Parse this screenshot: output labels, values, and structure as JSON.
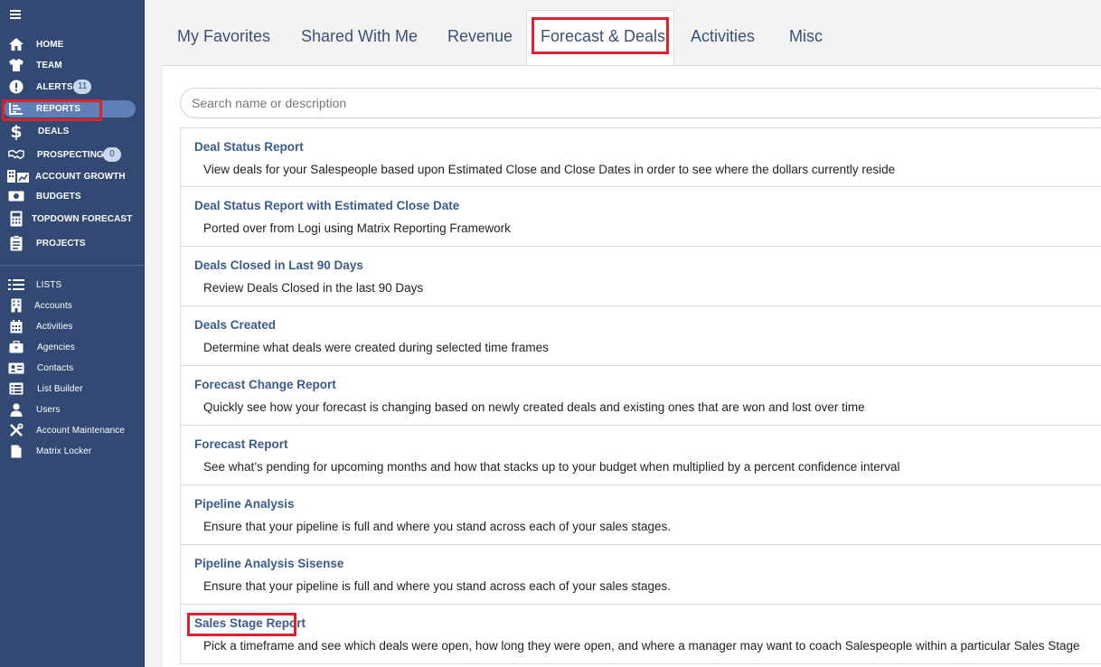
{
  "sidebar": {
    "main_items": [
      {
        "label": "HOME",
        "icon": "home-icon"
      },
      {
        "label": "TEAM",
        "icon": "shirt-icon"
      },
      {
        "label": "ALERTS",
        "icon": "alert-icon",
        "badge": "11"
      },
      {
        "label": "REPORTS",
        "icon": "report-chart-icon"
      },
      {
        "label": "DEALS",
        "icon": "dollar-icon"
      },
      {
        "label": "PROSPECTING",
        "icon": "handshake-icon",
        "badge": "0"
      },
      {
        "label": "ACCOUNT GROWTH",
        "icon": "building-chart-icon"
      },
      {
        "label": "BUDGETS",
        "icon": "money-bill-icon"
      },
      {
        "label": "TOPDOWN FORECAST",
        "icon": "calculator-icon"
      },
      {
        "label": "PROJECTS",
        "icon": "clipboard-icon"
      }
    ],
    "lists_header": "LISTS",
    "list_items": [
      {
        "label": "Accounts",
        "icon": "building-icon"
      },
      {
        "label": "Activities",
        "icon": "calendar-icon"
      },
      {
        "label": "Agencies",
        "icon": "briefcase-icon"
      },
      {
        "label": "Contacts",
        "icon": "contact-card-icon"
      },
      {
        "label": "List Builder",
        "icon": "list-builder-icon"
      },
      {
        "label": "Users",
        "icon": "user-icon"
      },
      {
        "label": "Account Maintenance",
        "icon": "tools-icon"
      },
      {
        "label": "Matrix Locker",
        "icon": "file-icon"
      }
    ]
  },
  "tabs": [
    {
      "label": "My Favorites"
    },
    {
      "label": "Shared With Me"
    },
    {
      "label": "Revenue"
    },
    {
      "label": "Forecast & Deals",
      "active": true
    },
    {
      "label": "Activities"
    },
    {
      "label": "Misc"
    }
  ],
  "search": {
    "placeholder": "Search name or description",
    "value": ""
  },
  "reports": [
    {
      "title": "Deal Status Report",
      "description": "View deals for your Salespeople based upon Estimated Close and Close Dates in order to see where the dollars currently reside"
    },
    {
      "title": "Deal Status Report with Estimated Close Date",
      "description": "Ported over from Logi using Matrix Reporting Framework"
    },
    {
      "title": "Deals Closed in Last 90 Days",
      "description": "Review Deals Closed in the last 90 Days"
    },
    {
      "title": "Deals Created",
      "description": "Determine what deals were created during selected time frames"
    },
    {
      "title": "Forecast Change Report",
      "description": "Quickly see how your forecast is changing based on newly created deals and existing ones that are won and lost over time"
    },
    {
      "title": "Forecast Report",
      "description": "See what’s pending for upcoming months and how that stacks up to your budget when multiplied by a percent confidence interval"
    },
    {
      "title": "Pipeline Analysis",
      "description": "Ensure that your pipeline is full and where you stand across each of your sales stages."
    },
    {
      "title": "Pipeline Analysis Sisense",
      "description": "Ensure that your pipeline is full and where you stand across each of your sales stages."
    },
    {
      "title": "Sales Stage Report",
      "description": "Pick a timeframe and see which deals were open, how long they were open, and where a manager may want to coach Salespeople within a particular Sales Stage"
    }
  ],
  "colors": {
    "sidebar_bg": "#324a73",
    "active_pill": "#5f7fb9",
    "highlight": "#e0202a",
    "link": "#3b5b8a"
  }
}
